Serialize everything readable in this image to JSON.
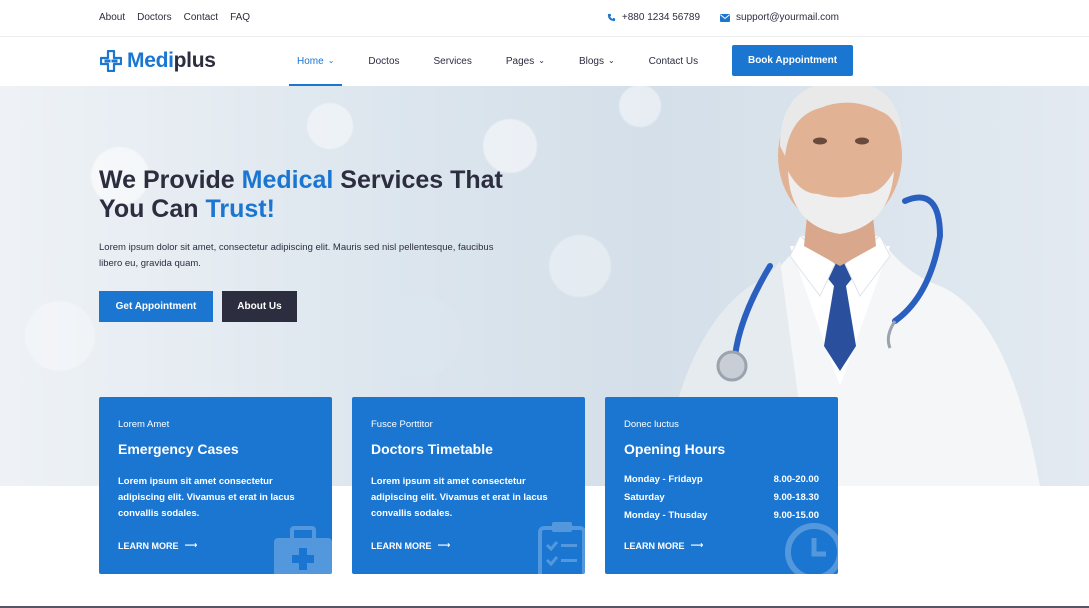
{
  "topbar": {
    "links": [
      "About",
      "Doctors",
      "Contact",
      "FAQ"
    ],
    "phone": "+880 1234 56789",
    "email": "support@yourmail.com"
  },
  "header": {
    "logo_part1": "Medi",
    "logo_part2": "plus",
    "nav": [
      {
        "label": "Home",
        "dropdown": true,
        "active": true
      },
      {
        "label": "Doctos",
        "dropdown": false
      },
      {
        "label": "Services",
        "dropdown": false
      },
      {
        "label": "Pages",
        "dropdown": true
      },
      {
        "label": "Blogs",
        "dropdown": true
      },
      {
        "label": "Contact Us",
        "dropdown": false
      }
    ],
    "book_button": "Book Appointment"
  },
  "hero": {
    "title_a": "We Provide ",
    "title_hl1": "Medical",
    "title_b": " Services That You Can ",
    "title_hl2": "Trust!",
    "text": "Lorem ipsum dolor sit amet, consectetur adipiscing elit. Mauris sed nisl pellentesque, faucibus libero eu, gravida quam.",
    "btn_primary": "Get Appointment",
    "btn_secondary": "About Us"
  },
  "cards": [
    {
      "sub": "Lorem Amet",
      "title": "Emergency Cases",
      "desc": "Lorem ipsum sit amet consectetur adipiscing elit. Vivamus et erat in lacus convallis sodales.",
      "more": "LEARN MORE",
      "icon": "first-aid-kit-icon"
    },
    {
      "sub": "Fusce Porttitor",
      "title": "Doctors Timetable",
      "desc": "Lorem ipsum sit amet consectetur adipiscing elit. Vivamus et erat in lacus convallis sodales.",
      "more": "LEARN MORE",
      "icon": "clipboard-icon"
    },
    {
      "sub": "Donec luctus",
      "title": "Opening Hours",
      "hours": [
        {
          "day": "Monday - Fridayp",
          "time": "8.00-20.00"
        },
        {
          "day": "Saturday",
          "time": "9.00-18.30"
        },
        {
          "day": "Monday - Thusday",
          "time": "9.00-15.00"
        }
      ],
      "more": "LEARN MORE",
      "icon": "clock-icon"
    }
  ],
  "colors": {
    "primary": "#1a76d1",
    "dark": "#2c2d3f"
  }
}
